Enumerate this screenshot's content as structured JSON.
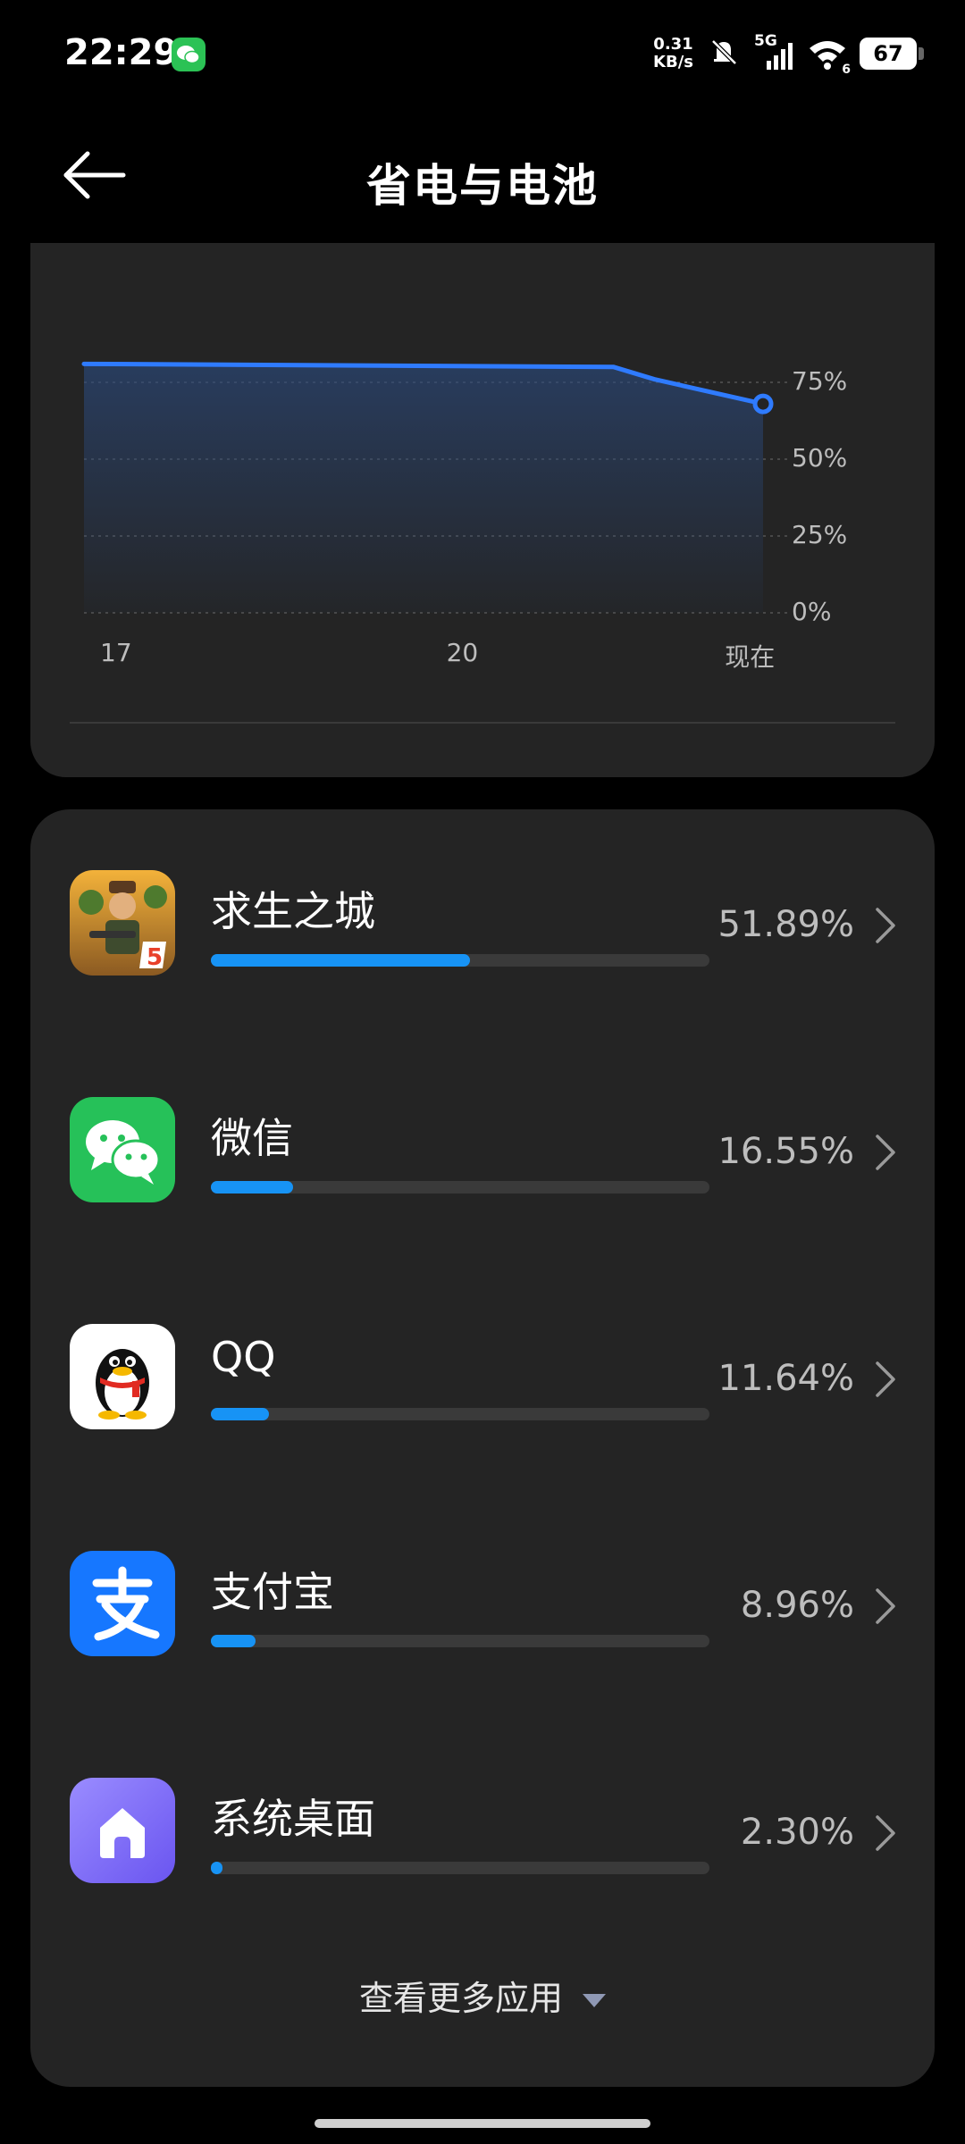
{
  "status_bar": {
    "time": "22:29",
    "net_speed_value": "0.31",
    "net_speed_unit": "KB/s",
    "network": "5G",
    "wifi_badge": "6",
    "battery_level": "67"
  },
  "header": {
    "title": "省电与电池",
    "back_icon": "arrow-left-icon"
  },
  "chart_data": {
    "type": "area",
    "x_ticks": [
      "17",
      "20",
      "现在"
    ],
    "y_ticks": [
      "75%",
      "50%",
      "25%",
      "0%"
    ],
    "ylim": [
      0,
      100
    ],
    "line_color": "#2F7BFF",
    "series": [
      {
        "points": [
          [
            0,
            81
          ],
          [
            0.78,
            80
          ],
          [
            0.84,
            76
          ],
          [
            0.9,
            73
          ],
          [
            1.0,
            68
          ]
        ]
      }
    ]
  },
  "apps": [
    {
      "name": "求生之城",
      "percent": "51.89%",
      "usage": 0.5189,
      "icon": "game-icon"
    },
    {
      "name": "微信",
      "percent": "16.55%",
      "usage": 0.1655,
      "icon": "wechat-icon"
    },
    {
      "name": "QQ",
      "percent": "11.64%",
      "usage": 0.1164,
      "icon": "qq-penguin-icon"
    },
    {
      "name": "支付宝",
      "percent": "8.96%",
      "usage": 0.0896,
      "icon": "alipay-icon"
    },
    {
      "name": "系统桌面",
      "percent": "2.30%",
      "usage": 0.023,
      "icon": "home-icon"
    }
  ],
  "more_label": "查看更多应用",
  "colors": {
    "accent": "#1793F5",
    "card": "#242424",
    "background": "#000000"
  }
}
